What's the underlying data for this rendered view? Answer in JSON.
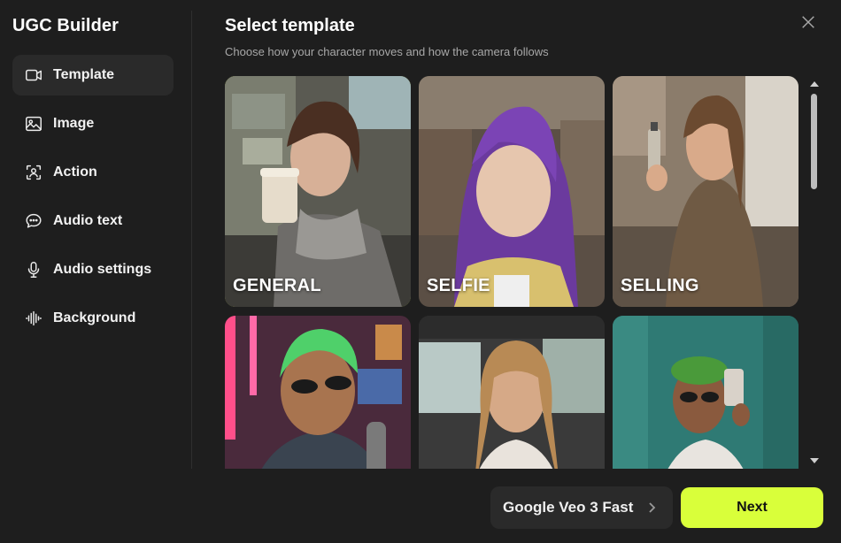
{
  "app": {
    "title": "UGC Builder"
  },
  "sidebar": {
    "items": [
      {
        "label": "Template",
        "icon": "video-icon",
        "active": true
      },
      {
        "label": "Image",
        "icon": "image-icon",
        "active": false
      },
      {
        "label": "Action",
        "icon": "person-scan-icon",
        "active": false
      },
      {
        "label": "Audio text",
        "icon": "chat-bubble-icon",
        "active": false
      },
      {
        "label": "Audio settings",
        "icon": "microphone-icon",
        "active": false
      },
      {
        "label": "Background",
        "icon": "waveform-icon",
        "active": false
      }
    ]
  },
  "header": {
    "title": "Select template",
    "subtitle": "Choose how your character moves and how the camera follows"
  },
  "templates": [
    {
      "label": "GENERAL",
      "selected": true
    },
    {
      "label": "SELFIE",
      "selected": false
    },
    {
      "label": "SELLING",
      "selected": false
    },
    {
      "label": "",
      "selected": false
    },
    {
      "label": "",
      "selected": false
    },
    {
      "label": "",
      "selected": false
    }
  ],
  "footer": {
    "model_label": "Google Veo 3 Fast",
    "next_label": "Next"
  },
  "colors": {
    "accent": "#d9ff3a",
    "background": "#1e1e1e",
    "panel": "#2a2a2a"
  }
}
